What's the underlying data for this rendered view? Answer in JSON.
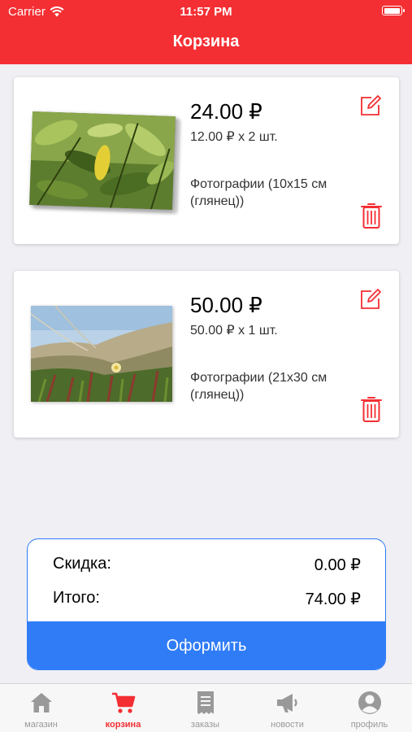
{
  "status_bar": {
    "carrier": "Carrier",
    "time": "11:57 PM"
  },
  "header": {
    "title": "Корзина"
  },
  "cart": {
    "items": [
      {
        "total": "24.00 ₽",
        "unit_line": "12.00 ₽ x 2 шт.",
        "description": "Фотографии (10x15 см (глянец))"
      },
      {
        "total": "50.00 ₽",
        "unit_line": "50.00 ₽ x 1 шт.",
        "description": "Фотографии (21x30 см (глянец))"
      }
    ]
  },
  "summary": {
    "discount_label": "Скидка:",
    "discount_value": "0.00 ₽",
    "total_label": "Итого:",
    "total_value": "74.00 ₽",
    "checkout_label": "Оформить"
  },
  "tabbar": {
    "tabs": [
      {
        "label": "магазин",
        "icon": "home-icon"
      },
      {
        "label": "корзина",
        "icon": "cart-icon",
        "active": true
      },
      {
        "label": "заказы",
        "icon": "orders-icon"
      },
      {
        "label": "новости",
        "icon": "megaphone-icon"
      },
      {
        "label": "профиль",
        "icon": "profile-icon"
      }
    ]
  },
  "colors": {
    "accent_red": "#f42f33",
    "accent_blue": "#2f7cf6",
    "background": "#efeff4",
    "tab_inactive": "#999999"
  }
}
